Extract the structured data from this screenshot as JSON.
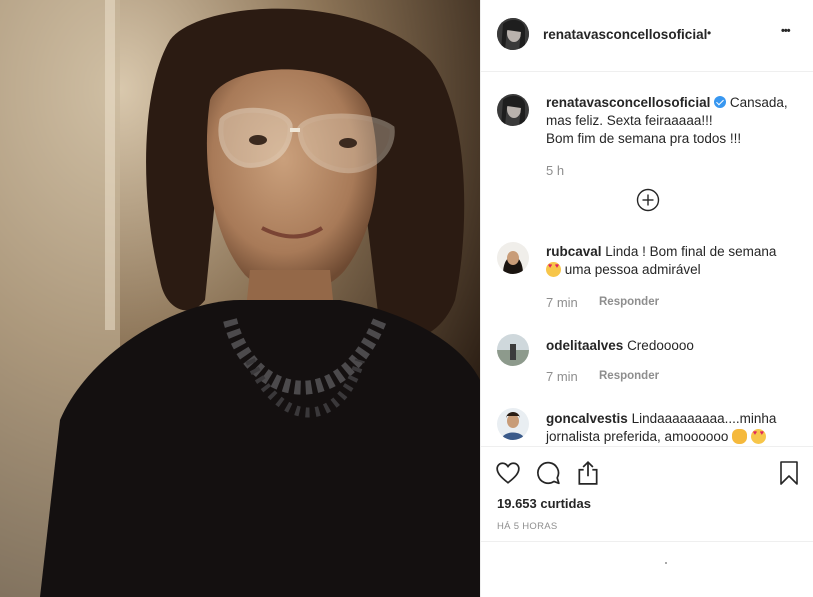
{
  "post": {
    "author": "renatavasconcellosoficial",
    "follow_dot": "•",
    "more": "•••",
    "caption_author": "renatavasconcellosoficial",
    "caption_line1": "Cansada,",
    "caption_line2": "mas feliz. Sexta feiraaaaa!!!",
    "caption_line3": "Bom fim de semana pra todos !!!",
    "caption_time": "5 h"
  },
  "comments": [
    {
      "user": "rubcaval",
      "text_line1": "Linda ! Bom final de semana",
      "text_line2": "uma pessoa admirável",
      "time": "7 min",
      "reply_label": "Responder"
    },
    {
      "user": "odelitaalves",
      "text_line1": "Credooooo",
      "time": "7 min",
      "reply_label": "Responder"
    },
    {
      "user": "goncalvestis",
      "text_line1": "Lindaaaaaaaaa....minha",
      "text_line2": "jornalista preferida, amoooooo"
    }
  ],
  "stats": {
    "likes": "19.653 curtidas",
    "timestamp": "HÁ 5 HORAS"
  },
  "colors": {
    "verified": "#3897f0",
    "muted": "#8e8e8e",
    "text": "#262626",
    "divider": "#efefef"
  },
  "icons": [
    "heart-icon",
    "comment-icon",
    "share-icon",
    "bookmark-icon",
    "load-more-icon",
    "verified-badge-icon"
  ]
}
